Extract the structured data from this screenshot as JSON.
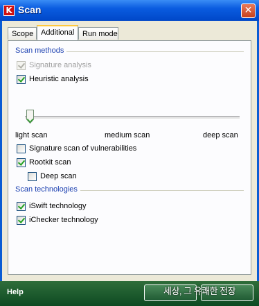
{
  "window": {
    "title": "Scan",
    "close_glyph": "✕",
    "logo_letter": "K"
  },
  "tabs": [
    {
      "label": "Scope",
      "active": false
    },
    {
      "label": "Additional",
      "active": true
    },
    {
      "label": "Run mode",
      "active": false
    }
  ],
  "scan_methods": {
    "heading": "Scan methods",
    "signature_analysis": {
      "label": "Signature analysis",
      "checked": true,
      "disabled": true
    },
    "heuristic_analysis": {
      "label": "Heuristic analysis",
      "checked": true,
      "disabled": false
    },
    "slider": {
      "labels": [
        "light scan",
        "medium scan",
        "deep scan"
      ],
      "value": 0
    },
    "signature_vulnerabilities": {
      "label": "Signature scan of vulnerabilities",
      "checked": false
    },
    "rootkit_scan": {
      "label": "Rootkit scan",
      "checked": true
    },
    "deep_scan": {
      "label": "Deep scan",
      "checked": false
    }
  },
  "scan_technologies": {
    "heading": "Scan technologies",
    "iswift": {
      "label": "iSwift technology",
      "checked": true
    },
    "ichecker": {
      "label": "iChecker technology",
      "checked": true
    }
  },
  "footer": {
    "help_label": "Help",
    "overlay_text": "세상, 그 유쾌한 전장"
  }
}
